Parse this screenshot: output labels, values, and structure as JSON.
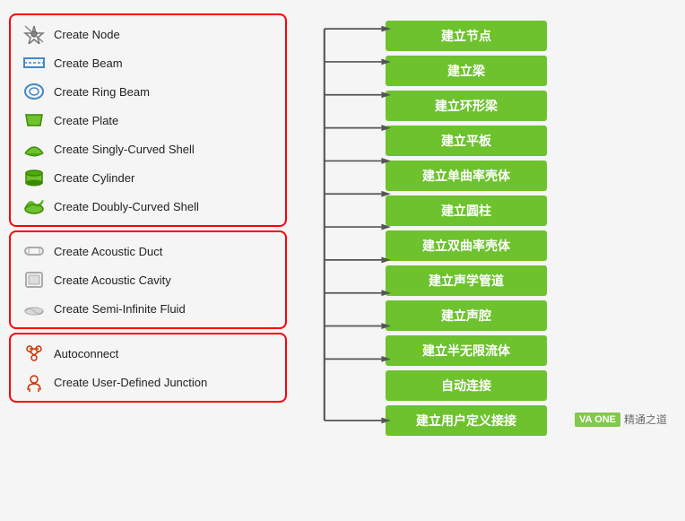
{
  "groups": [
    {
      "id": "group1",
      "items": [
        {
          "id": "create-node",
          "label": "Create Node",
          "icon": "node"
        },
        {
          "id": "create-beam",
          "label": "Create Beam",
          "icon": "beam"
        },
        {
          "id": "create-ring-beam",
          "label": "Create Ring Beam",
          "icon": "ring-beam"
        },
        {
          "id": "create-plate",
          "label": "Create Plate",
          "icon": "plate"
        },
        {
          "id": "create-singly-curved-shell",
          "label": "Create Singly-Curved Shell",
          "icon": "singly-curved"
        },
        {
          "id": "create-cylinder",
          "label": "Create Cylinder",
          "icon": "cylinder"
        },
        {
          "id": "create-doubly-curved-shell",
          "label": "Create Doubly-Curved Shell",
          "icon": "doubly-curved"
        }
      ]
    },
    {
      "id": "group2",
      "items": [
        {
          "id": "create-acoustic-duct",
          "label": "Create Acoustic Duct",
          "icon": "acoustic-duct"
        },
        {
          "id": "create-acoustic-cavity",
          "label": "Create Acoustic Cavity",
          "icon": "acoustic-cavity"
        },
        {
          "id": "create-semi-infinite-fluid",
          "label": "Create Semi-Infinite Fluid",
          "icon": "semi-infinite"
        }
      ]
    },
    {
      "id": "group3",
      "items": [
        {
          "id": "autoconnect",
          "label": "Autoconnect",
          "icon": "autoconnect"
        },
        {
          "id": "create-user-defined-junction",
          "label": "Create User-Defined Junction",
          "icon": "user-junction"
        }
      ]
    }
  ],
  "chinese_labels": [
    "建立节点",
    "建立梁",
    "建立环形梁",
    "建立平板",
    "建立单曲率壳体",
    "建立圆柱",
    "建立双曲率壳体",
    "建立声学管道",
    "建立声腔",
    "建立半无限流体",
    "自动连接",
    "建立用户定义接接"
  ],
  "watermark": {
    "logo": "VA ONE",
    "text": "精通之道"
  }
}
